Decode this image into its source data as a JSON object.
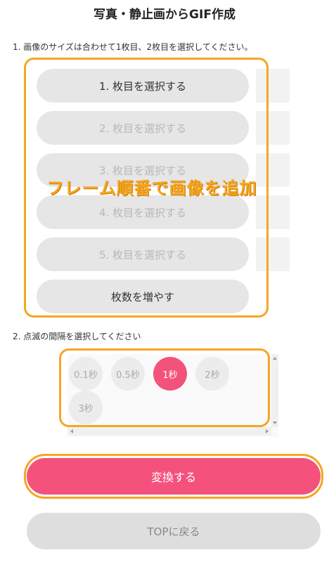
{
  "page": {
    "title": "写真・静止画からGIF作成"
  },
  "step1": {
    "instruction": "1. 画像のサイズは合わせて1枚目、2枚目を選択してください。",
    "frames": [
      {
        "label": "1. 枚目を選択する",
        "enabled": true
      },
      {
        "label": "2. 枚目を選択する",
        "enabled": false
      },
      {
        "label": "3. 枚目を選択する",
        "enabled": false
      },
      {
        "label": "4. 枚目を選択する",
        "enabled": false
      },
      {
        "label": "5. 枚目を選択する",
        "enabled": false
      }
    ],
    "add_label": "枚数を増やす",
    "overlay_caption": "フレーム順番で画像を追加"
  },
  "step2": {
    "instruction": "2. 点滅の間隔を選択してください",
    "options": [
      "0.1秒",
      "0.5秒",
      "1秒",
      "2秒",
      "3秒"
    ],
    "selected": "1秒"
  },
  "actions": {
    "convert_label": "変換する",
    "back_label": "TOPに戻る"
  },
  "colors": {
    "accent": "#f4527d",
    "highlight": "#f5a623",
    "disabled": "#dedede"
  }
}
